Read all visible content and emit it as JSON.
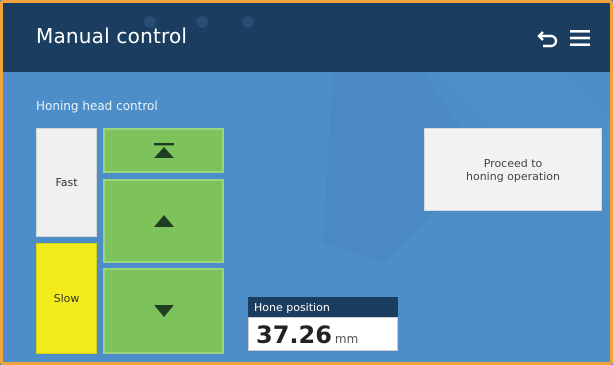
{
  "header": {
    "title": "Manual control",
    "back_icon": "undo-arrow-icon",
    "menu_icon": "hamburger-menu-icon"
  },
  "section": {
    "label": "Honing head control"
  },
  "speed": {
    "fast_label": "Fast",
    "slow_label": "Slow",
    "selected": "Slow"
  },
  "movement": {
    "top_icon": "move-to-top-icon",
    "up_icon": "arrow-up-icon",
    "down_icon": "arrow-down-icon"
  },
  "proceed": {
    "line1": "Proceed to",
    "line2": "honing operation"
  },
  "hone_position": {
    "label": "Hone position",
    "value": "37.26",
    "unit": "mm"
  },
  "colors": {
    "header_bg": "#1b3d60",
    "panel_bg": "#4d8ec8",
    "green": "#7dc25b",
    "yellow": "#f2ec1b",
    "frame": "#f2a23a"
  }
}
